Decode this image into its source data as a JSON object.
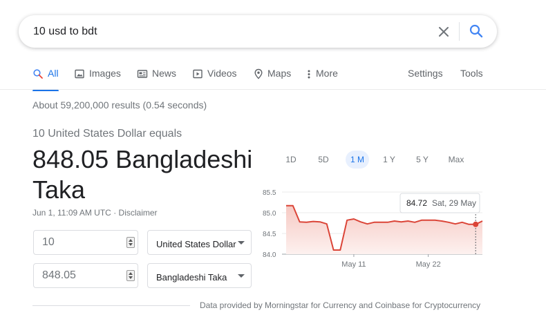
{
  "search": {
    "query": "10 usd to bdt"
  },
  "tabs": [
    {
      "label": "All",
      "icon": "search-icon"
    },
    {
      "label": "Images",
      "icon": "image-icon"
    },
    {
      "label": "News",
      "icon": "news-icon"
    },
    {
      "label": "Videos",
      "icon": "video-icon"
    },
    {
      "label": "Maps",
      "icon": "map-pin-icon"
    },
    {
      "label": "More",
      "icon": "more-vert-icon"
    }
  ],
  "tools": {
    "settings": "Settings",
    "tools": "Tools"
  },
  "result_stats": "About 59,200,000 results (0.54 seconds)",
  "converter": {
    "equals_label": "10 United States Dollar equals",
    "converted": "848.05 Bangladeshi Taka",
    "timestamp": "Jun 1, 11:09 AM UTC",
    "separator": "·",
    "disclaimer": "Disclaimer",
    "from_amount": "10",
    "from_currency": "United States Dollar",
    "to_amount": "848.05",
    "to_currency": "Bangladeshi Taka"
  },
  "ranges": [
    "1D",
    "5D",
    "1 M",
    "1 Y",
    "5 Y",
    "Max"
  ],
  "active_range": "1 M",
  "colors": {
    "accent": "#1a73e8",
    "line": "#db4437",
    "fill": "#fce8e6"
  },
  "chart_data": {
    "type": "area",
    "y_ticks": [
      "85.5",
      "85.0",
      "84.5",
      "84.0"
    ],
    "ylim": [
      84.0,
      85.5
    ],
    "x_ticks": [
      {
        "label": "May 11",
        "index": 10
      },
      {
        "label": "May 22",
        "index": 21
      }
    ],
    "values": [
      85.17,
      85.17,
      84.78,
      84.77,
      84.79,
      84.78,
      84.73,
      84.1,
      84.1,
      84.82,
      84.85,
      84.78,
      84.73,
      84.77,
      84.77,
      84.77,
      84.8,
      84.78,
      84.8,
      84.77,
      84.82,
      84.82,
      84.82,
      84.8,
      84.77,
      84.73,
      84.77,
      84.72,
      84.72,
      84.8
    ],
    "tooltip": {
      "value": "84.72",
      "date": "Sat, 29 May",
      "index": 28
    }
  },
  "attribution": "Data provided by Morningstar for Currency and Coinbase for Cryptocurrency"
}
